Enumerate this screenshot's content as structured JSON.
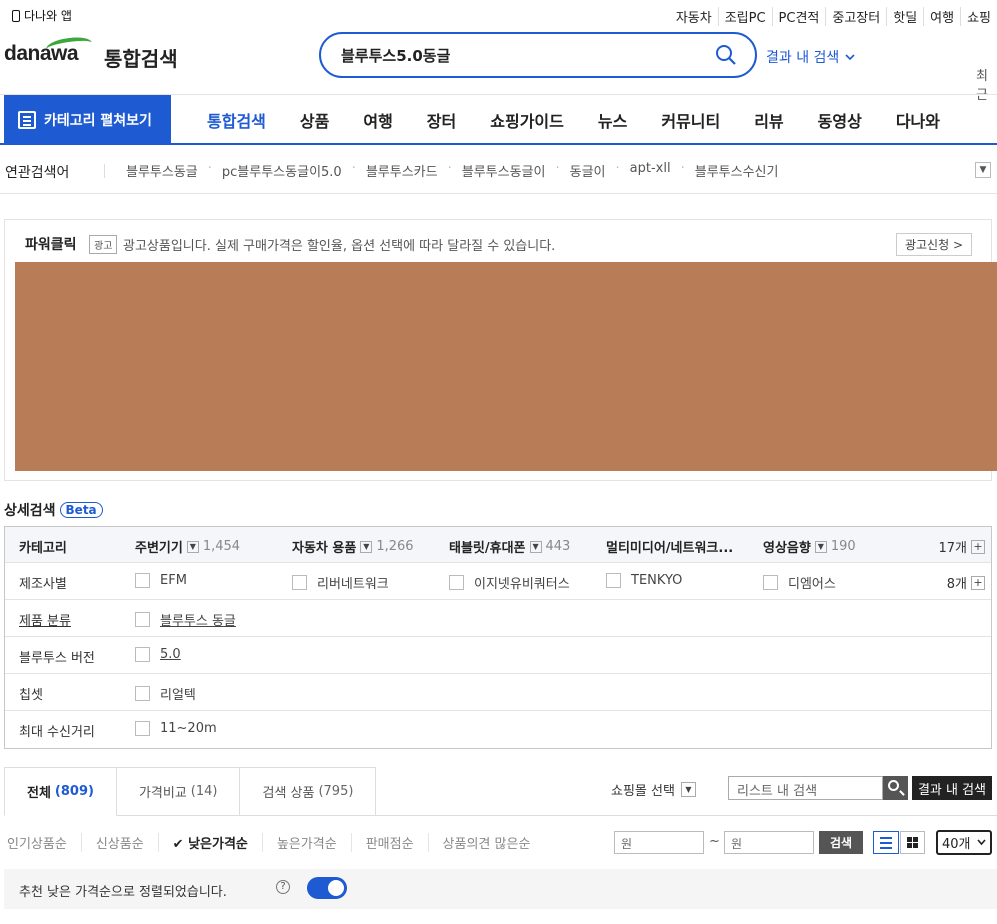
{
  "top_bar": {
    "app_link": "다나와 앱",
    "links": [
      "자동차",
      "조립PC",
      "PC견적",
      "중고장터",
      "핫딜",
      "여행",
      "쇼핑"
    ]
  },
  "header": {
    "logo": "danawa",
    "service_title": "통합검색",
    "search_value": "블루투스5.0동글",
    "result_search_label": "결과 내 검색",
    "recent_label": "최근"
  },
  "nav": {
    "category_button": "카테고리 펼쳐보기",
    "tabs": [
      "통합검색",
      "상품",
      "여행",
      "장터",
      "쇼핑가이드",
      "뉴스",
      "커뮤니티",
      "리뷰",
      "동영상",
      "다나와"
    ]
  },
  "related": {
    "title": "연관검색어",
    "keywords": [
      "블루투스동글",
      "pc블루투스동글이5.0",
      "블루투스카드",
      "블루투스동글이",
      "동글이",
      "apt-xll",
      "블루투스수신기"
    ]
  },
  "powerclick": {
    "title": "파워클릭",
    "badge": "광고",
    "note": "광고상품입니다. 실제 구매가격은 할인율, 옵션 선택에 따라 달라질 수 있습니다.",
    "apply_button": "광고신청 >",
    "banner_color": "#b87d57"
  },
  "detail_search": {
    "title": "상세검색",
    "beta": "Beta",
    "category_row": {
      "label": "카테고리",
      "items": [
        {
          "name": "주변기기",
          "count": "1,454"
        },
        {
          "name": "자동차 용품",
          "count": "1,266"
        },
        {
          "name": "태블릿/휴대폰",
          "count": "443"
        },
        {
          "name": "멀티미디어/네트워크...",
          "count": ""
        },
        {
          "name": "영상음향",
          "count": "190"
        }
      ],
      "more": "17개"
    },
    "maker_row": {
      "label": "제조사별",
      "items": [
        "EFM",
        "리버네트워크",
        "이지넷유비쿼터스",
        "TENKYO",
        "디엠어스"
      ],
      "more": "8개"
    },
    "rows": [
      {
        "label": "제품 분류",
        "value": "블루투스 동글"
      },
      {
        "label": "블루투스 버전",
        "value": "5.0"
      },
      {
        "label": "칩셋",
        "value": "리얼텍"
      },
      {
        "label": "최대 수신거리",
        "value": "11~20m"
      }
    ]
  },
  "result_tabs": [
    {
      "label": "전체",
      "count": "(809)"
    },
    {
      "label": "가격비교",
      "count": "(14)"
    },
    {
      "label": "검색 상품",
      "count": "(795)"
    }
  ],
  "toolbar": {
    "mall_select": "쇼핑몰 선택",
    "list_search_placeholder": "리스트 내 검색",
    "result_search_button": "결과 내 검색"
  },
  "sort": {
    "options": [
      "인기상품순",
      "신상품순",
      "낮은가격순",
      "높은가격순",
      "판매점순",
      "상품의견 많은순"
    ],
    "active_index": 2,
    "price_min_placeholder": "원",
    "price_max_placeholder": "원",
    "tilde": "~",
    "search_button": "검색",
    "per_page": "40개"
  },
  "info": {
    "text": "추천 낮은 가격순으로 정렬되었습니다.",
    "help": "?",
    "toggle_on": true
  },
  "colors": {
    "accent": "#1e5bd3",
    "logo_green": "#3ca83c"
  }
}
